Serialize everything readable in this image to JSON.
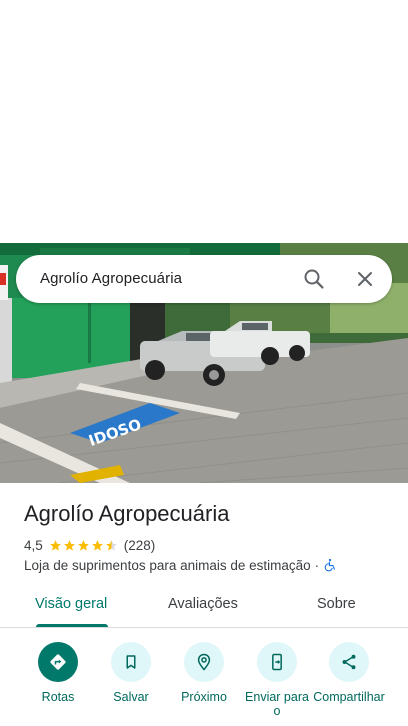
{
  "search": {
    "query": "Agrolío Agropecuária"
  },
  "place": {
    "name": "Agrolío Agropecuária",
    "rating": "4,5",
    "rating_value": 4.5,
    "reviews": "(228)",
    "category": "Loja de suprimentos para animais de estimação",
    "separator": "·"
  },
  "photo": {
    "painted_text": "IDOSO"
  },
  "tabs": [
    {
      "label": "Visão geral",
      "active": true
    },
    {
      "label": "Avaliações",
      "active": false
    },
    {
      "label": "Sobre",
      "active": false
    }
  ],
  "actions": [
    {
      "label": "Rotas",
      "icon": "directions-icon"
    },
    {
      "label": "Salvar",
      "icon": "bookmark-icon"
    },
    {
      "label": "Próximo",
      "icon": "nearby-icon"
    },
    {
      "label": "Enviar para o",
      "icon": "send-to-phone-icon"
    },
    {
      "label": "Compartilhar",
      "icon": "share-icon"
    }
  ],
  "colors": {
    "accent": "#00796b",
    "action_bg": "#e0f7fa",
    "star": "#fbbc04",
    "wheelchair": "#1a73e8"
  }
}
